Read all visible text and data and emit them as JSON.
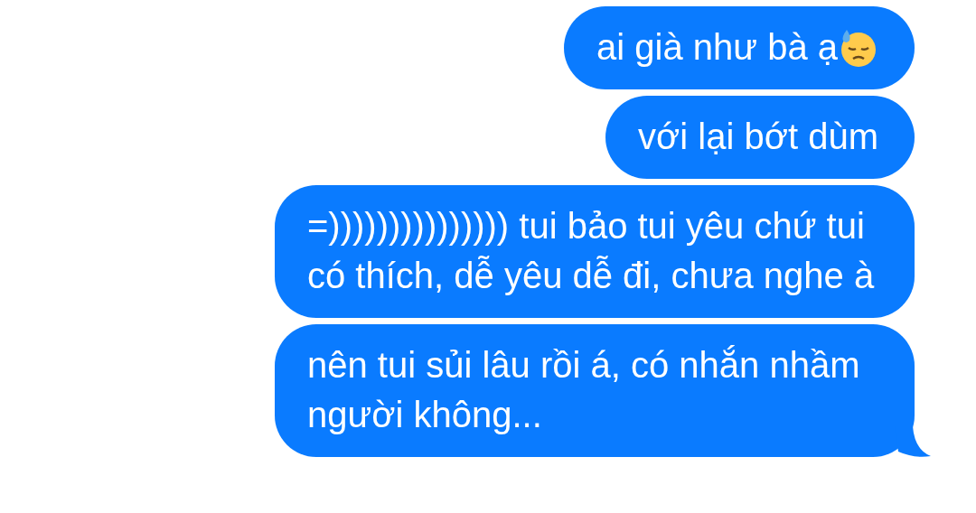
{
  "messages": [
    {
      "text": "ai già như bà ạ",
      "emoji": true,
      "tail": false
    },
    {
      "text": "với lại bớt dùm",
      "emoji": false,
      "tail": false
    },
    {
      "text": "=))))))))))))))) tui bảo tui yêu chứ tui có thích, dễ yêu dễ đi, chưa nghe à",
      "emoji": false,
      "tail": false
    },
    {
      "text": "nên tui sủi lâu rồi á, có nhắn nhầm người không...",
      "emoji": false,
      "tail": true
    }
  ]
}
